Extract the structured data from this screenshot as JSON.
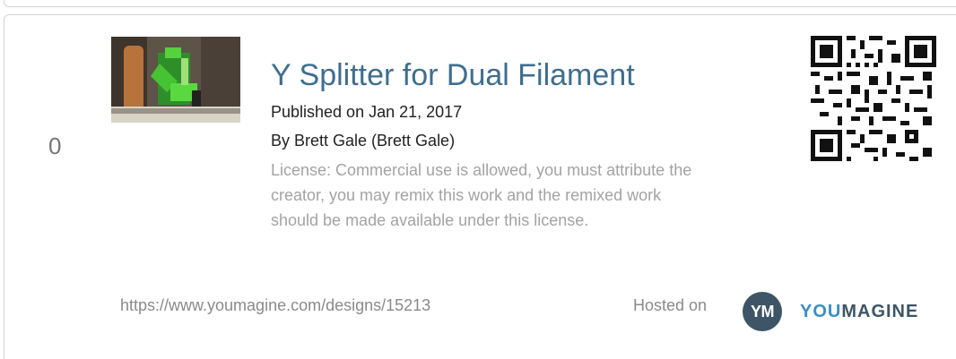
{
  "card": {
    "index": "0",
    "thumbnail_icon": "printer-photo",
    "title": "Y Splitter for Dual Filament",
    "published": "Published on Jan 21, 2017",
    "author": "By Brett Gale (Brett Gale)",
    "license": "License: Commercial use is allowed, you must attribute the creator, you may remix this work and the remixed work should be made available under this license.",
    "url": "https://www.youmagine.com/designs/15213",
    "hosted_label": "Hosted on",
    "badge_text": "YM",
    "brand_you": "YOU",
    "brand_magine": "MAGINE"
  },
  "colors": {
    "title": "#3f6e8e",
    "brand_dark": "#3d5566",
    "brand_blue": "#3b8fc4"
  }
}
